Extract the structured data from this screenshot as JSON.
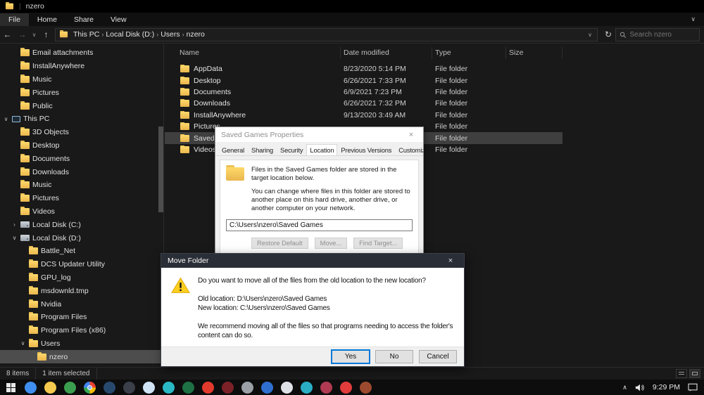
{
  "icons": {
    "back": "←",
    "forward": "→",
    "up": "↑",
    "refresh": "↻",
    "chevron_down": "∨",
    "chevron_right": "›",
    "chevron_up": "∧",
    "close": "×"
  },
  "titlebar": {
    "app_title": "nzero"
  },
  "ribbon": {
    "tabs": [
      "File",
      "Home",
      "Share",
      "View"
    ]
  },
  "addressbar": {
    "breadcrumb": [
      "This PC",
      "Local Disk (D:)",
      "Users",
      "nzero"
    ],
    "search_placeholder": "Search nzero"
  },
  "sidebar": {
    "items": [
      {
        "label": "Email attachments",
        "icon": "folder",
        "indent": 2,
        "expander": "",
        "selected": false
      },
      {
        "label": "InstallAnywhere",
        "icon": "folder",
        "indent": 2,
        "expander": "",
        "selected": false
      },
      {
        "label": "Music",
        "icon": "folder",
        "indent": 2,
        "expander": "",
        "selected": false
      },
      {
        "label": "Pictures",
        "icon": "folder",
        "indent": 2,
        "expander": "",
        "selected": false
      },
      {
        "label": "Public",
        "icon": "folder",
        "indent": 2,
        "expander": "",
        "selected": false
      },
      {
        "label": "This PC",
        "icon": "pc",
        "indent": 1,
        "expander": "expanded",
        "selected": false
      },
      {
        "label": "3D Objects",
        "icon": "folder",
        "indent": 2,
        "expander": "",
        "selected": false
      },
      {
        "label": "Desktop",
        "icon": "folder",
        "indent": 2,
        "expander": "",
        "selected": false
      },
      {
        "label": "Documents",
        "icon": "folder",
        "indent": 2,
        "expander": "",
        "selected": false
      },
      {
        "label": "Downloads",
        "icon": "folder",
        "indent": 2,
        "expander": "",
        "selected": false
      },
      {
        "label": "Music",
        "icon": "folder",
        "indent": 2,
        "expander": "",
        "selected": false
      },
      {
        "label": "Pictures",
        "icon": "folder",
        "indent": 2,
        "expander": "",
        "selected": false
      },
      {
        "label": "Videos",
        "icon": "folder",
        "indent": 2,
        "expander": "",
        "selected": false
      },
      {
        "label": "Local Disk (C:)",
        "icon": "drive",
        "indent": 2,
        "expander": "collapsed",
        "selected": false
      },
      {
        "label": "Local Disk (D:)",
        "icon": "drive",
        "indent": 2,
        "expander": "expanded",
        "selected": false
      },
      {
        "label": "Battle_Net",
        "icon": "folder",
        "indent": 3,
        "expander": "",
        "selected": false
      },
      {
        "label": "DCS Updater Utility",
        "icon": "folder",
        "indent": 3,
        "expander": "",
        "selected": false
      },
      {
        "label": "GPU_log",
        "icon": "folder",
        "indent": 3,
        "expander": "",
        "selected": false
      },
      {
        "label": "msdownld.tmp",
        "icon": "folder",
        "indent": 3,
        "expander": "",
        "selected": false
      },
      {
        "label": "Nvidia",
        "icon": "folder",
        "indent": 3,
        "expander": "",
        "selected": false
      },
      {
        "label": "Program Files",
        "icon": "folder",
        "indent": 3,
        "expander": "",
        "selected": false
      },
      {
        "label": "Program Files (x86)",
        "icon": "folder",
        "indent": 3,
        "expander": "",
        "selected": false
      },
      {
        "label": "Users",
        "icon": "folder",
        "indent": 3,
        "expander": "expanded",
        "selected": false
      },
      {
        "label": "nzero",
        "icon": "folder",
        "indent": 4,
        "expander": "",
        "selected": true
      }
    ]
  },
  "file_list": {
    "columns": [
      "Name",
      "Date modified",
      "Type",
      "Size"
    ],
    "rows": [
      {
        "name": "AppData",
        "date": "8/23/2020 5:14 PM",
        "type": "File folder",
        "size": "",
        "selected": false
      },
      {
        "name": "Desktop",
        "date": "6/26/2021 7:33 PM",
        "type": "File folder",
        "size": "",
        "selected": false
      },
      {
        "name": "Documents",
        "date": "6/9/2021 7:23 PM",
        "type": "File folder",
        "size": "",
        "selected": false
      },
      {
        "name": "Downloads",
        "date": "6/26/2021 7:32 PM",
        "type": "File folder",
        "size": "",
        "selected": false
      },
      {
        "name": "InstallAnywhere",
        "date": "9/13/2020 3:49 AM",
        "type": "File folder",
        "size": "",
        "selected": false
      },
      {
        "name": "Pictures",
        "date": "",
        "type": "File folder",
        "size": "",
        "selected": false
      },
      {
        "name": "Saved Games",
        "date": "",
        "type": "File folder",
        "size": "",
        "selected": true
      },
      {
        "name": "Videos",
        "date": "",
        "type": "File folder",
        "size": "",
        "selected": false
      }
    ]
  },
  "status_bar": {
    "item_count": "8 items",
    "selection": "1 item selected"
  },
  "properties_dialog": {
    "title": "Saved Games Properties",
    "tabs": [
      "General",
      "Sharing",
      "Security",
      "Location",
      "Previous Versions",
      "Customize"
    ],
    "active_tab": "Location",
    "intro": "Files in the Saved Games folder are stored in the target location below.",
    "body": "You can change where files in this folder are stored to another place on this hard drive, another drive, or another computer on your network.",
    "path": "C:\\Users\\nzero\\Saved Games",
    "restore_label": "Restore Default",
    "move_label": "Move...",
    "find_label": "Find Target..."
  },
  "move_dialog": {
    "title": "Move Folder",
    "question": "Do you want to move all of the files from the old location to the new location?",
    "old_location": "Old location: D:\\Users\\nzero\\Saved Games",
    "new_location": "New location: C:\\Users\\nzero\\Saved Games",
    "note": "We recommend moving all of the files so that programs needing to access the folder's content can do so.",
    "yes_label": "Yes",
    "no_label": "No",
    "cancel_label": "Cancel"
  },
  "taskbar": {
    "time": "9:29 PM",
    "apps": [
      {
        "id": "edge",
        "color": "#3f8ef0"
      },
      {
        "id": "file-explorer",
        "color": "#f5c84e"
      },
      {
        "id": "app-3",
        "color": "#3b9e4e"
      },
      {
        "id": "chrome",
        "color": "conic"
      },
      {
        "id": "app-5",
        "color": "#27496e"
      },
      {
        "id": "app-6",
        "color": "#3a3f4a"
      },
      {
        "id": "app-7",
        "color": "#cfe3f5"
      },
      {
        "id": "app-8",
        "color": "#2ab8c5"
      },
      {
        "id": "app-9",
        "color": "#1e7145"
      },
      {
        "id": "app-10",
        "color": "#e33a2e"
      },
      {
        "id": "app-11",
        "color": "#7c2128"
      },
      {
        "id": "app-12",
        "color": "#9aa0a6"
      },
      {
        "id": "app-13",
        "color": "#2f6fd0"
      },
      {
        "id": "app-14",
        "color": "#dfe3e8"
      },
      {
        "id": "app-15",
        "color": "#29aec4"
      },
      {
        "id": "app-16",
        "color": "#b03a52"
      },
      {
        "id": "app-17",
        "color": "#e03c3c"
      },
      {
        "id": "app-18",
        "color": "#9c4a2f"
      }
    ]
  }
}
